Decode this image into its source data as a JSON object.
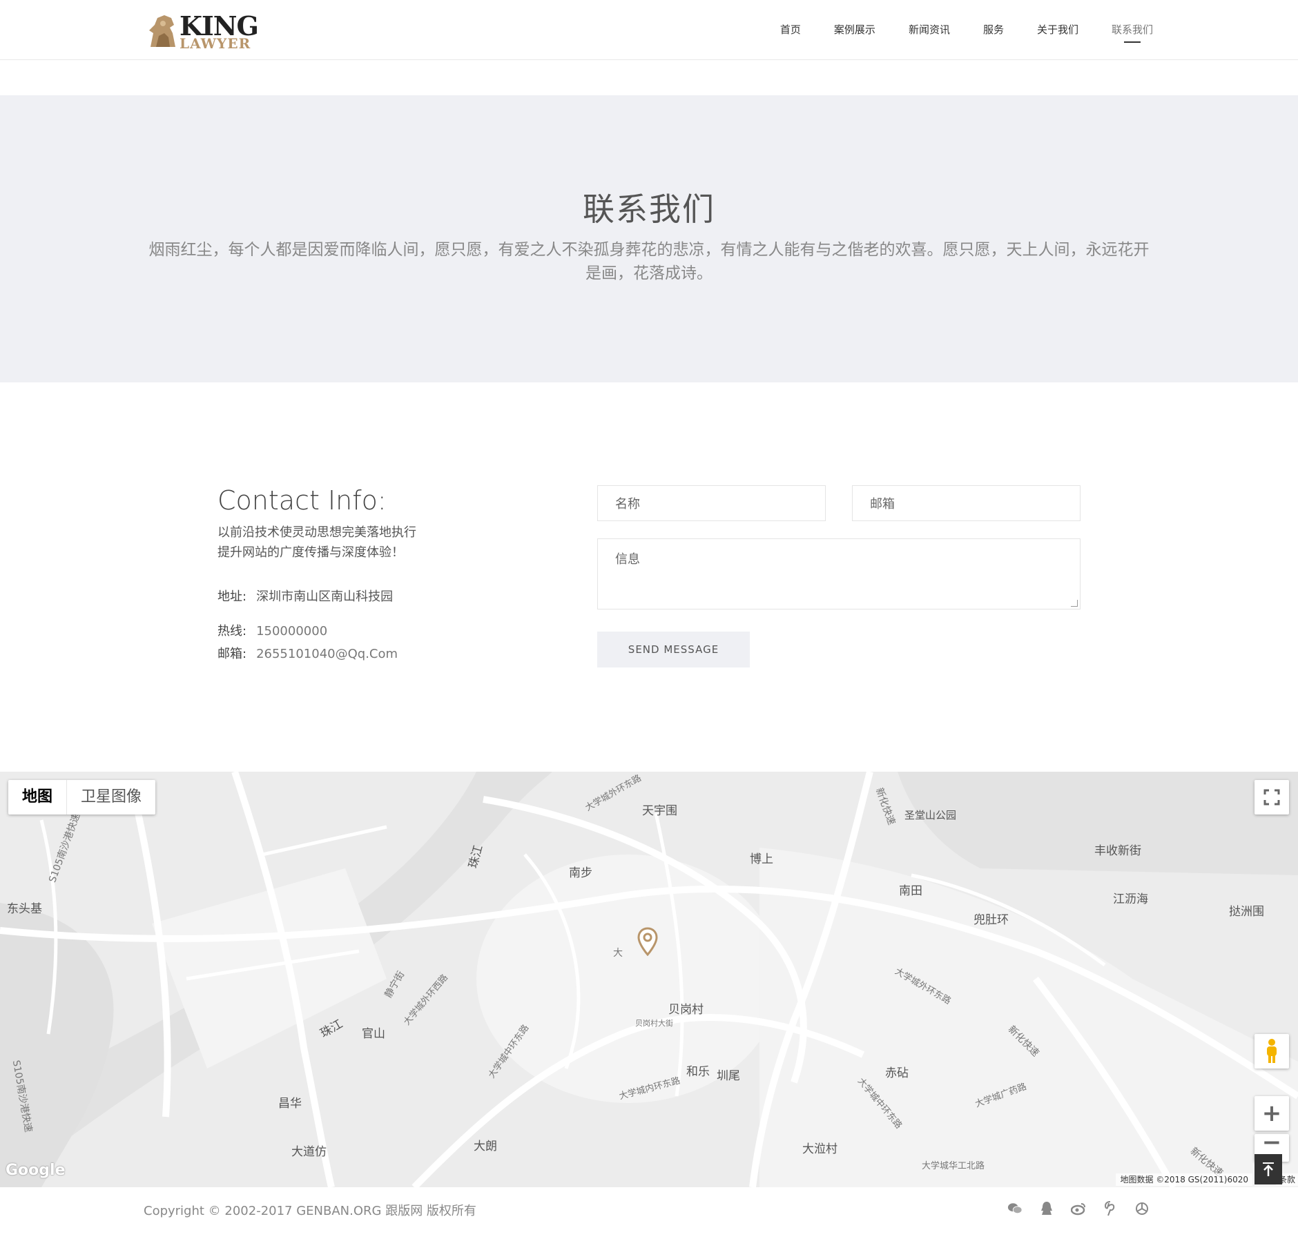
{
  "header": {
    "logo_top": "KING",
    "logo_bottom": "LAWYER",
    "nav": [
      {
        "label": "首页"
      },
      {
        "label": "案例展示"
      },
      {
        "label": "新闻资讯"
      },
      {
        "label": "服务"
      },
      {
        "label": "关于我们"
      },
      {
        "label": "联系我们",
        "active": true
      }
    ]
  },
  "hero": {
    "title": "联系我们",
    "desc": "烟雨红尘，每个人都是因爱而降临人间，愿只愿，有爱之人不染孤身葬花的悲凉，有情之人能有与之偕老的欢喜。愿只愿，天上人间，永远花开是画，花落成诗。"
  },
  "contact": {
    "title": "Contact Info:",
    "intro_line1": "以前沿技术使灵动思想完美落地执行",
    "intro_line2": "提升网站的广度传播与深度体验！",
    "address_label": "地址:",
    "address": "深圳市南山区南山科技园",
    "hotline_label": "热线:",
    "hotline": "150000000",
    "email_label": "邮箱:",
    "email": "2655101040@Qq.Com"
  },
  "form": {
    "name_placeholder": "名称",
    "email_placeholder": "邮箱",
    "message_placeholder": "信息",
    "send_label": "SEND MESSAGE"
  },
  "map": {
    "type_map": "地图",
    "type_satellite": "卫星图像",
    "attribution": "地图数据 ©2018 GS(2011)6020",
    "attribution_tail": "条款",
    "logo": "Google",
    "labels": {
      "tianyuwei": "天宇围",
      "shengtang": "圣堂山公园",
      "fengshou": "丰收新街",
      "nanbu": "南步",
      "boshang": "博上",
      "nantian": "南田",
      "jianglihai": "江沥海",
      "doudu": "兜肚环",
      "tingzhou": "挞洲围",
      "dongtouji": "东头基",
      "zhujiang1": "珠江",
      "zhujiang2": "珠江",
      "guanshan": "官山",
      "beigang": "贝岗村",
      "beigang_st": "贝岗村大街",
      "hele": "和乐",
      "zhenwei": "圳尾",
      "chijian": "赤砧",
      "changhua": "昌华",
      "dadaofang": "大道仿",
      "dalang": "大朗",
      "daxi": "大涖村",
      "xinhua1": "新化快速",
      "xinhua2": "新化快速",
      "xinhua3": "新化快速",
      "s105_1": "S105南沙港快速",
      "s105_2": "S105南沙港快速",
      "outer_ring1": "大学城外环东路",
      "outer_ring2": "大学城外环东路",
      "outer_ring3": "大学城外环西路",
      "inner_ring": "大学城内环东路",
      "mid_ring": "大学城中环东路",
      "mid_ring2": "大学城中环东路",
      "guangyao": "大学城广药路",
      "huagong": "大学城华工北路",
      "jingning": "静宁街",
      "da": "大"
    }
  },
  "footer": {
    "copyright": "Copyright © 2002-2017 GENBAN.ORG 跟版网 版权所有",
    "social": [
      "wechat-icon",
      "qq-icon",
      "weibo-icon",
      "pinterest-icon",
      "share-icon"
    ]
  },
  "colors": {
    "accent": "#b8956a",
    "hero_bg": "#eff0f4",
    "button_bg": "#eff0f4"
  }
}
